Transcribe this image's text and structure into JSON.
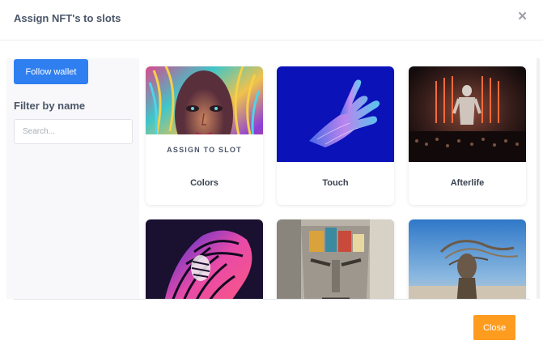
{
  "modal": {
    "title": "Assign NFT's to slots",
    "close_icon": "×"
  },
  "sidebar": {
    "follow_wallet": "Follow wallet",
    "filter_label": "Filter by name",
    "search_placeholder": "Search..."
  },
  "nfts": [
    {
      "name": "Colors",
      "action": "ASSIGN TO SLOT"
    },
    {
      "name": "Touch"
    },
    {
      "name": "Afterlife"
    },
    {
      "name": ""
    },
    {
      "name": ""
    },
    {
      "name": ""
    }
  ],
  "footer": {
    "close_label": "Close"
  },
  "colors": {
    "primary": "#2f7ff0",
    "close_button": "#fd9c1f"
  }
}
